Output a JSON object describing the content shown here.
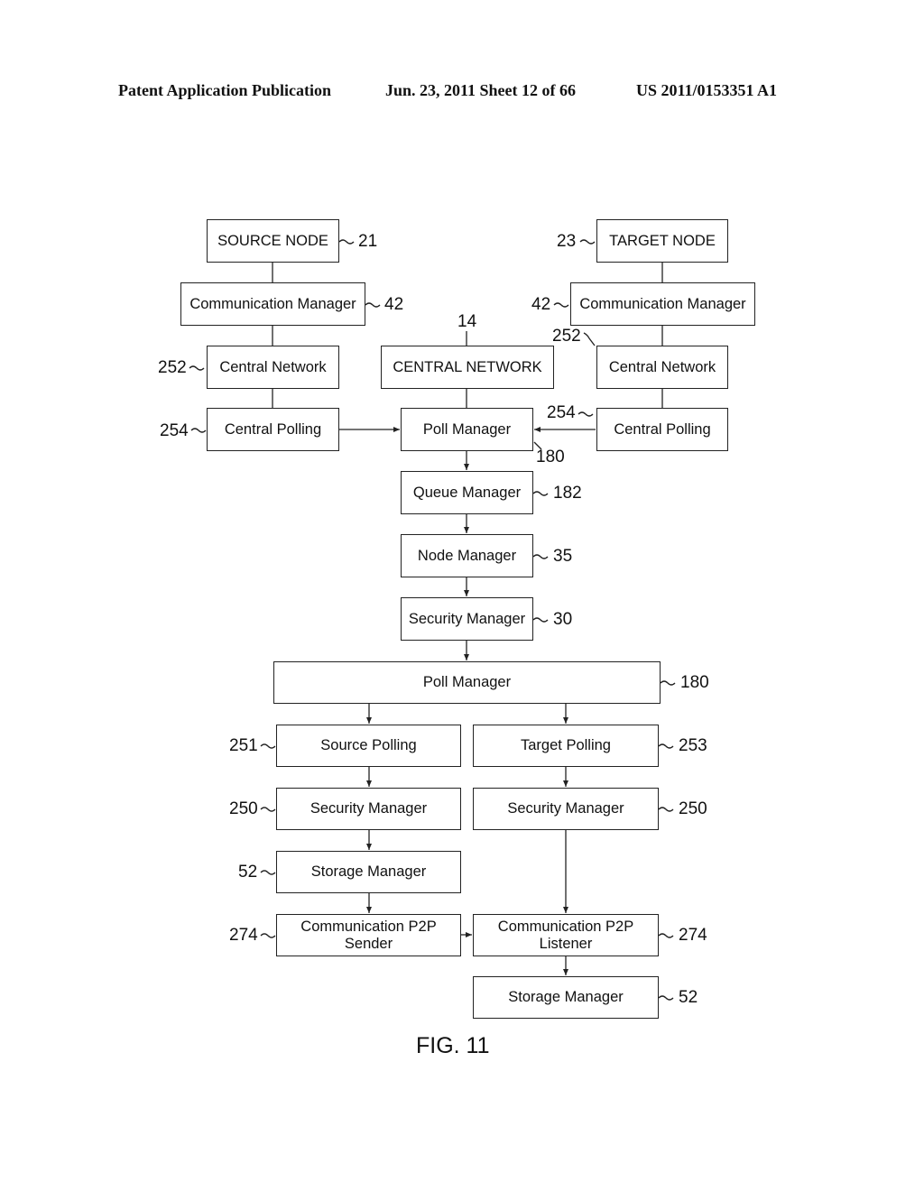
{
  "header": {
    "publication": "Patent Application Publication",
    "date_sheet": "Jun. 23, 2011  Sheet 12 of 66",
    "number": "US 2011/0153351 A1"
  },
  "boxes": {
    "source_node": "SOURCE NODE",
    "target_node": "TARGET NODE",
    "comm_mgr_left": "Communication Manager",
    "comm_mgr_right": "Communication Manager",
    "central_network_left": "Central Network",
    "central_network_main": "CENTRAL NETWORK",
    "central_network_right": "Central Network",
    "central_polling_left": "Central Polling",
    "poll_manager_top": "Poll Manager",
    "central_polling_right": "Central Polling",
    "queue_manager": "Queue Manager",
    "node_manager": "Node Manager",
    "security_manager_mid": "Security Manager",
    "poll_manager_wide": "Poll Manager",
    "source_polling": "Source Polling",
    "target_polling": "Target Polling",
    "security_manager_left": "Security Manager",
    "security_manager_right": "Security Manager",
    "storage_manager_left": "Storage Manager",
    "comm_p2p_sender": "Communication P2P\nSender",
    "comm_p2p_listener": "Communication P2P\nListener",
    "storage_manager_bottom": "Storage Manager"
  },
  "refs": {
    "source_node": "21",
    "target_node": "23",
    "comm_mgr_left": "42",
    "comm_mgr_right": "42",
    "central_network_main": "14",
    "central_network_left": "252",
    "central_network_right": "252",
    "central_polling_left": "254",
    "central_polling_right": "254",
    "poll_manager_top": "180",
    "queue_manager": "182",
    "node_manager": "35",
    "security_manager_mid": "30",
    "poll_manager_wide": "180",
    "source_polling": "251",
    "target_polling": "253",
    "security_manager_left": "250",
    "security_manager_right": "250",
    "storage_manager_left": "52",
    "comm_p2p_sender": "274",
    "comm_p2p_listener": "274",
    "storage_manager_bottom": "52"
  },
  "figure_label": "FIG. 11"
}
